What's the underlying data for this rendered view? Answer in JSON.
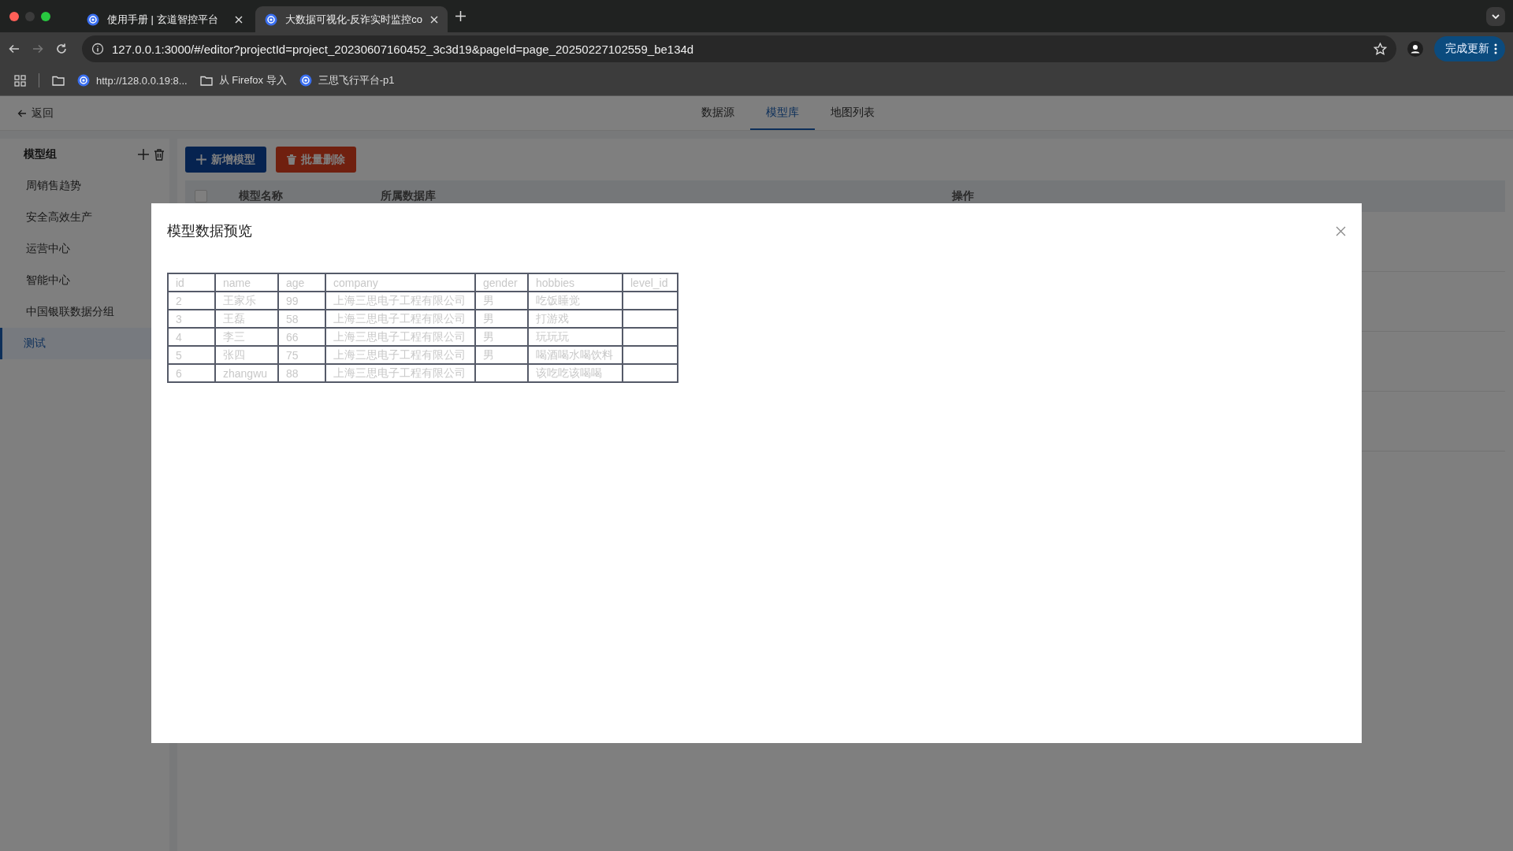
{
  "browser": {
    "tabs": [
      {
        "title": "使用手册 | 玄道智控平台",
        "selected": false
      },
      {
        "title": "大数据可视化-反诈实时监控co",
        "selected": true
      }
    ],
    "url": "127.0.0.1:3000/#/editor?projectId=project_20230607160452_3c3d19&pageId=page_20250227102559_be134d",
    "update_button": "完成更新",
    "bookmarks": [
      {
        "label": "http://128.0.0.19:8...",
        "kind": "site"
      },
      {
        "label": "从 Firefox 导入",
        "kind": "folder"
      },
      {
        "label": "三思飞行平台-p1",
        "kind": "site"
      }
    ]
  },
  "app": {
    "back": "返回",
    "tabs": [
      {
        "label": "数据源",
        "selected": false
      },
      {
        "label": "模型库",
        "selected": true
      },
      {
        "label": "地图列表",
        "selected": false
      }
    ],
    "sidebar": {
      "title": "模型组",
      "items": [
        {
          "label": "周销售趋势",
          "selected": false
        },
        {
          "label": "安全高效生产",
          "selected": false
        },
        {
          "label": "运营中心",
          "selected": false
        },
        {
          "label": "智能中心",
          "selected": false
        },
        {
          "label": "中国银联数据分组",
          "selected": false
        },
        {
          "label": "测试",
          "selected": true
        }
      ]
    },
    "toolbar": [
      {
        "label": "新增模型",
        "kind": "add"
      },
      {
        "label": "批量删除",
        "kind": "delete"
      }
    ],
    "table": {
      "select_all_checked": false,
      "columns": [
        "模型名称",
        "所属数据库",
        "操作"
      ]
    },
    "modal": {
      "title": "模型数据预览",
      "columns": [
        "id",
        "name",
        "age",
        "company",
        "gender",
        "hobbies",
        "level_id"
      ],
      "rows": [
        [
          "2",
          "王家乐",
          "99",
          "上海三思电子工程有限公司",
          "男",
          "吃饭睡觉",
          ""
        ],
        [
          "3",
          "王磊",
          "58",
          "上海三思电子工程有限公司",
          "男",
          "打游戏",
          ""
        ],
        [
          "4",
          "李三",
          "66",
          "上海三思电子工程有限公司",
          "男",
          "玩玩玩",
          ""
        ],
        [
          "5",
          "张四",
          "75",
          "上海三思电子工程有限公司",
          "男",
          "喝酒喝水喝饮料",
          ""
        ],
        [
          "6",
          "zhangwu",
          "88",
          "上海三思电子工程有限公司",
          "",
          "该吃吃该喝喝",
          ""
        ]
      ]
    }
  }
}
